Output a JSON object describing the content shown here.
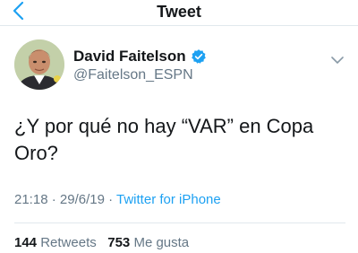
{
  "navbar": {
    "title": "Tweet",
    "back_icon": "chevron-left-icon"
  },
  "author": {
    "display_name": "David Faitelson",
    "handle": "@Faitelson_ESPN",
    "verified": true,
    "verified_icon": "verified-badge-icon"
  },
  "tweet": {
    "text": "¿Y por qué no hay “VAR” en Copa Oro?",
    "time": "21:18",
    "date": "29/6/19",
    "separator": "·",
    "source": "Twitter for iPhone"
  },
  "stats": {
    "retweets_count": "144",
    "retweets_label": "Retweets",
    "likes_count": "753",
    "likes_label": "Me gusta"
  },
  "colors": {
    "accent": "#1da1f2",
    "text": "#14171a",
    "secondary": "#657786",
    "divider": "#e1e8ed"
  }
}
